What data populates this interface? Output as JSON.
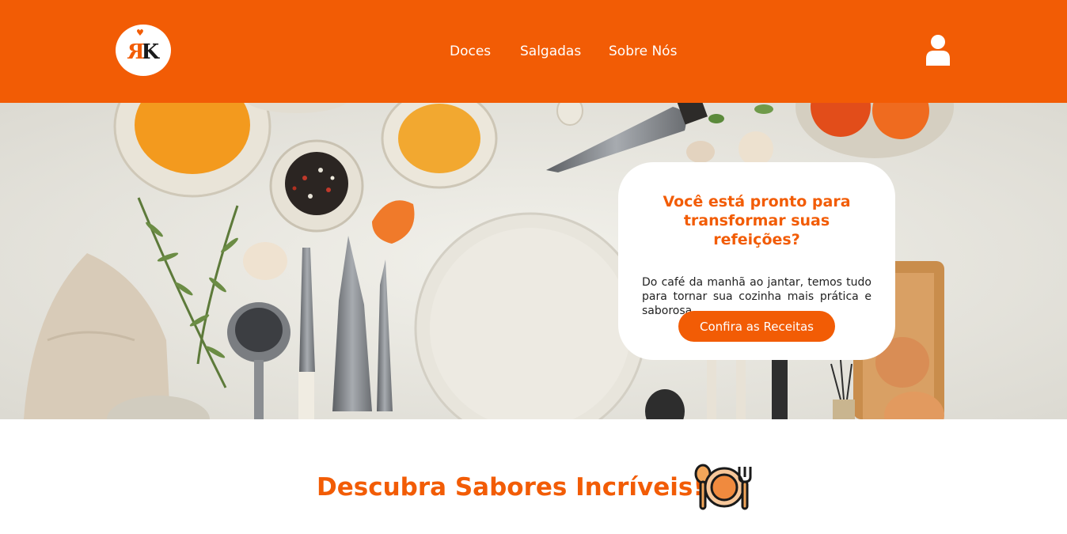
{
  "header": {
    "logo_text": "RK",
    "nav": [
      "Doces",
      "Salgadas",
      "Sobre Nós"
    ]
  },
  "hero": {
    "title": "Você está pronto para transformar suas refeições?",
    "text": "Do café da manhã ao jantar, temos tudo para tornar sua cozinha mais prática e saborosa.",
    "cta": "Confira as Receitas"
  },
  "section": {
    "title": "Descubra Sabores Incríveis!"
  },
  "colors": {
    "brand": "#f25c05"
  },
  "icons": [
    "user-icon",
    "plate-cutlery-icon"
  ]
}
